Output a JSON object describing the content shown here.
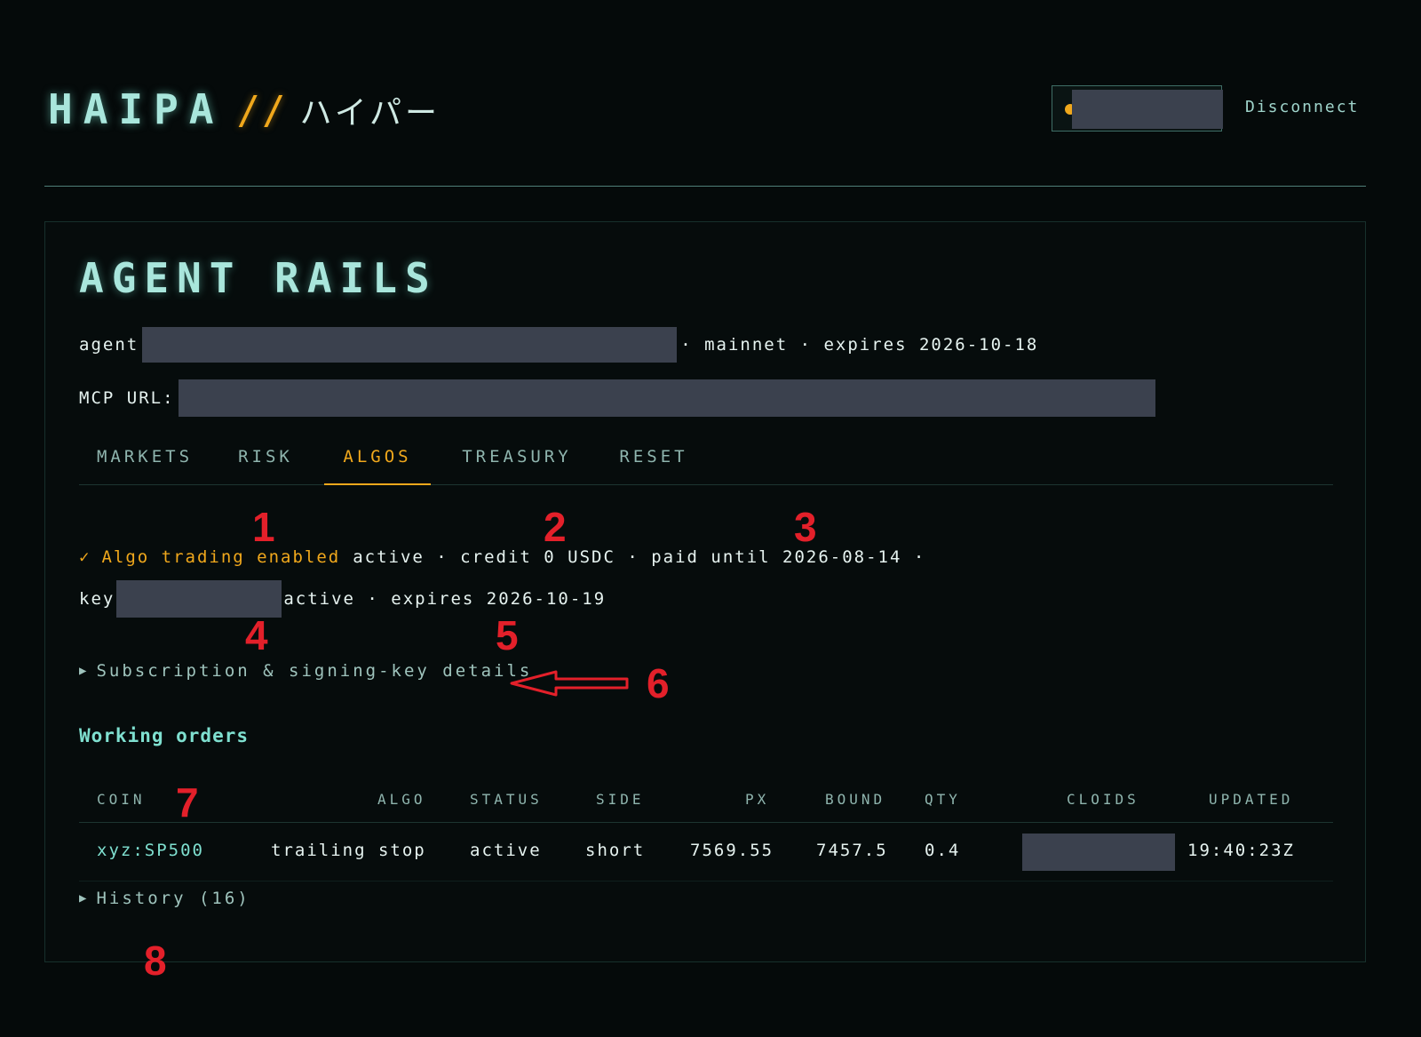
{
  "header": {
    "brand_main": "HAIPA",
    "brand_slash": "//",
    "brand_jp": "ハイパー",
    "disconnect_label": "Disconnect"
  },
  "panel": {
    "title": "AGENT RAILS",
    "agent_prefix": "agent",
    "agent_suffix": "· mainnet · expires 2026-10-18",
    "mcp_label": "MCP URL:"
  },
  "tabs": [
    {
      "label": "MARKETS"
    },
    {
      "label": "RISK"
    },
    {
      "label": "ALGOS"
    },
    {
      "label": "TREASURY"
    },
    {
      "label": "RESET"
    }
  ],
  "status": {
    "check_glyph": "✓",
    "enabled_label": "Algo trading enabled",
    "line1_rest": "active · credit 0 USDC · paid until 2026-08-14 ·",
    "key_prefix": "key",
    "line2_rest": "active · expires 2026-10-19"
  },
  "details": {
    "label": "Subscription & signing-key details"
  },
  "working_orders": {
    "title": "Working orders",
    "columns": [
      "COIN",
      "ALGO",
      "STATUS",
      "SIDE",
      "PX",
      "BOUND",
      "QTY",
      "CLOIDS",
      "UPDATED"
    ],
    "rows": [
      {
        "coin": "xyz:SP500",
        "algo": "trailing stop",
        "status": "active",
        "side": "short",
        "px": "7569.55",
        "bound": "7457.5",
        "qty": "0.4",
        "updated": "19:40:23Z"
      }
    ]
  },
  "history": {
    "label": "History (16)"
  },
  "annotations": [
    "1",
    "2",
    "3",
    "4",
    "5",
    "6",
    "7",
    "8"
  ],
  "colors": {
    "accent": "#f0a81c",
    "teal": "#7fe0d0",
    "background": "#050a0a",
    "annotation": "#e3202a"
  }
}
